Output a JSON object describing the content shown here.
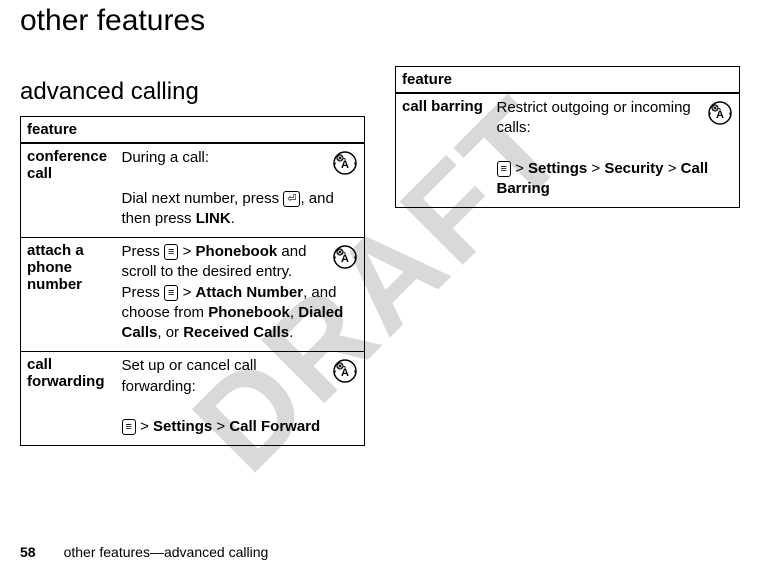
{
  "watermark": "DRAFT",
  "page_title": "other features",
  "section_title": "advanced calling",
  "table_header": "feature",
  "left_table": [
    {
      "name": "conference call",
      "desc1": "During a call:",
      "desc2_pre": "Dial next number, press ",
      "send_key": "⏎",
      "desc2_mid": ", and then press ",
      "link": "LINK",
      "desc2_end": "."
    },
    {
      "name": "attach a phone number",
      "press": "Press ",
      "menu_key": "≡",
      "gt": " > ",
      "phonebook": "Phonebook",
      "scroll": " and scroll to the desired entry. Press ",
      "attach": "Attach Number",
      "choose": ", and choose from ",
      "pb2": "Phonebook",
      "comma1": ", ",
      "dialed": "Dialed Calls",
      "comma2": ", or ",
      "received": "Received Calls",
      "period": "."
    },
    {
      "name": "call forwarding",
      "desc1": "Set up or cancel call forwarding:",
      "menu_key": "≡",
      "gt": " > ",
      "settings": "Settings",
      "callfwd": "Call Forward"
    }
  ],
  "right_table": [
    {
      "name": "call barring",
      "desc1": "Restrict outgoing or incoming calls:",
      "menu_key": "≡",
      "gt": " > ",
      "settings": "Settings",
      "security": "Security",
      "callbarring": "Call Barring"
    }
  ],
  "footer": {
    "page": "58",
    "text": "other features—advanced calling"
  }
}
